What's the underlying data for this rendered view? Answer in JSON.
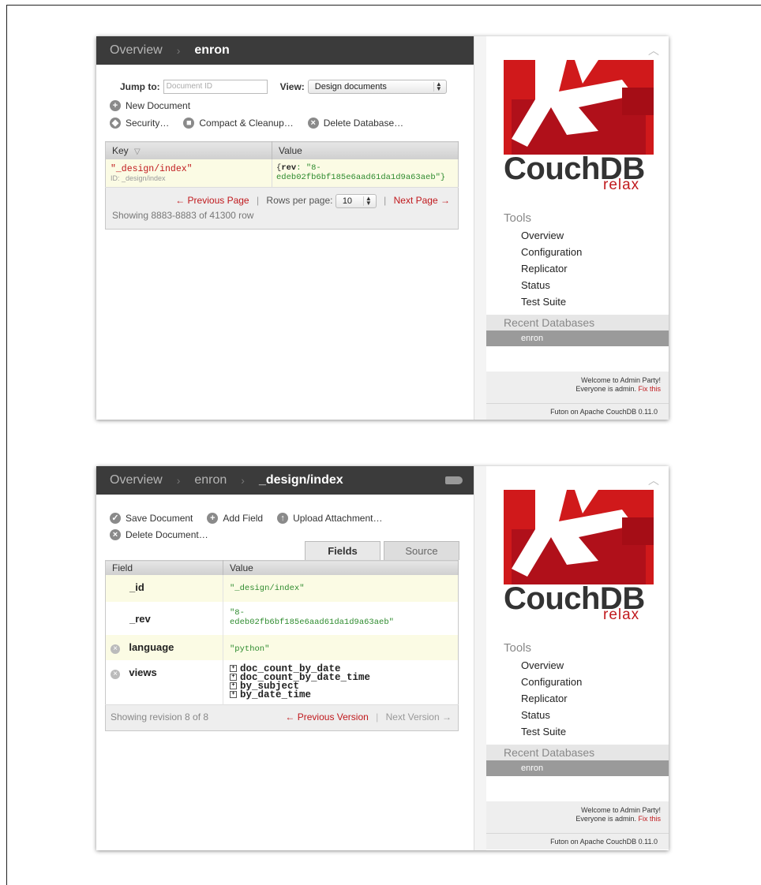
{
  "shot1": {
    "breadcrumb": [
      "Overview",
      "enron"
    ],
    "jump_label": "Jump to:",
    "jump_placeholder": "Document ID",
    "view_label": "View:",
    "view_value": "Design documents",
    "actions": {
      "new_document": "New Document",
      "security": "Security…",
      "compact": "Compact & Cleanup…",
      "delete_db": "Delete Database…"
    },
    "table": {
      "key_header": "Key",
      "value_header": "Value",
      "row": {
        "key": "\"_design/index\"",
        "id": "ID: _design/index",
        "value_prefix": "{",
        "value_rev_key": "rev",
        "value_rest": ": \"8-",
        "value_line2": "edeb02fb6bf185e6aad61da1d9a63aeb\"}"
      }
    },
    "pager": {
      "prev": "← Previous Page",
      "rows_label": "Rows per page:",
      "rows_value": "10",
      "next": "Next Page →",
      "showing": "Showing 8883-8883 of 41300 row"
    }
  },
  "shot2": {
    "breadcrumb": [
      "Overview",
      "enron",
      "_design/index"
    ],
    "actions": {
      "save": "Save Document",
      "add_field": "Add Field",
      "upload": "Upload Attachment…",
      "delete_doc": "Delete Document…"
    },
    "tabs": [
      "Fields",
      "Source"
    ],
    "table": {
      "field_header": "Field",
      "value_header": "Value",
      "rows": [
        {
          "field": "_id",
          "value": "\"_design/index\""
        },
        {
          "field": "_rev",
          "value1": "\"8-",
          "value2": "edeb02fb6bf185e6aad61da1d9a63aeb\""
        },
        {
          "field": "language",
          "value": "\"python\""
        },
        {
          "field": "views",
          "items": [
            "doc_count_by_date",
            "doc_count_by_date_time",
            "by_subject",
            "by_date_time"
          ]
        }
      ]
    },
    "footer": {
      "revision": "Showing revision 8 of 8",
      "prev": "← Previous Version",
      "next": "Next Version →"
    }
  },
  "sidebar": {
    "brand": "CouchDB",
    "tagline": "relax",
    "tools_heading": "Tools",
    "tools": [
      "Overview",
      "Configuration",
      "Replicator",
      "Status",
      "Test Suite"
    ],
    "recent_heading": "Recent Databases",
    "recent": [
      "enron"
    ],
    "welcome_line1": "Welcome to Admin Party!",
    "welcome_line2": "Everyone is admin.",
    "fix_link": "Fix this",
    "version": "Futon on Apache CouchDB 0.11.0"
  },
  "colors": {
    "brand_red": "#c0191d",
    "topbar": "#3b3b3b"
  }
}
